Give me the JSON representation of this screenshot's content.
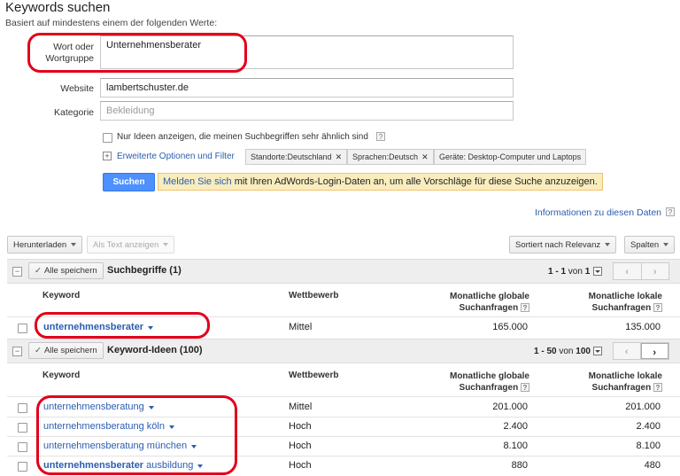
{
  "header": {
    "title": "Keywords suchen",
    "subtitle": "Basiert auf mindestens einem der folgenden Werte:"
  },
  "form": {
    "word_label_line1": "Wort oder",
    "word_label_line2": "Wortgruppe",
    "word_value": "Unternehmensberater",
    "website_label": "Website",
    "website_value": "lambertschuster.de",
    "category_label": "Kategorie",
    "category_placeholder": "Bekleidung",
    "similar_checkbox_label": "Nur Ideen anzeigen, die meinen Suchbegriffen sehr ähnlich sind",
    "advanced_options_link": "Erweiterte Optionen und Filter",
    "filters": [
      {
        "label": "Standorte:",
        "value": "Deutschland",
        "close": "✕"
      },
      {
        "label": "Sprachen:",
        "value": "Deutsch",
        "close": "✕"
      },
      {
        "label": "Geräte: ",
        "value": "Desktop-Computer und Laptops",
        "close": ""
      }
    ],
    "search_button": "Suchen",
    "notice_link": "Melden Sie sich",
    "notice_text": " mit Ihren AdWords-Login-Daten an, um alle Vorschläge für diese Suche anzuzeigen."
  },
  "info_link": "Informationen zu diesen Daten",
  "toolbar": {
    "download": "Herunterladen",
    "as_text": "Als Text anzeigen",
    "sorted": "Sortiert nach Relevanz",
    "columns": "Spalten"
  },
  "search_terms": {
    "save_all": "Alle speichern",
    "title": "Suchbegriffe (1)",
    "page_range": "1 - 1",
    "page_of": " von ",
    "page_total": "1",
    "col_keyword": "Keyword",
    "col_competition": "Wettbewerb",
    "col_global_1": "Monatliche globale",
    "col_global_2": "Suchanfragen",
    "col_local_1": "Monatliche lokale",
    "col_local_2": "Suchanfragen",
    "rows": [
      {
        "keyword": "unternehmensberater",
        "competition": "Mittel",
        "global": "165.000",
        "local": "135.000"
      }
    ]
  },
  "keyword_ideas": {
    "save_all": "Alle speichern",
    "title": "Keyword-Ideen (100)",
    "page_range": "1 - 50",
    "page_of": " von ",
    "page_total": "100",
    "col_keyword": "Keyword",
    "col_competition": "Wettbewerb",
    "col_global_1": "Monatliche globale",
    "col_global_2": "Suchanfragen",
    "col_local_1": "Monatliche lokale",
    "col_local_2": "Suchanfragen",
    "rows": [
      {
        "keyword_bold": "",
        "keyword_rest": "unternehmensberatung",
        "competition": "Mittel",
        "global": "201.000",
        "local": "201.000"
      },
      {
        "keyword_bold": "",
        "keyword_rest": "unternehmensberatung köln",
        "competition": "Hoch",
        "global": "2.400",
        "local": "2.400"
      },
      {
        "keyword_bold": "",
        "keyword_rest": "unternehmensberatung münchen",
        "competition": "Hoch",
        "global": "8.100",
        "local": "8.100"
      },
      {
        "keyword_bold": "unternehmensberater",
        "keyword_rest": " ausbildung",
        "competition": "Hoch",
        "global": "880",
        "local": "480"
      }
    ]
  },
  "colors": {
    "link": "#2a5db0",
    "search_button": "#4d90fe",
    "notice_bg": "#f9edbe",
    "highlight_oval": "#e2001a"
  }
}
